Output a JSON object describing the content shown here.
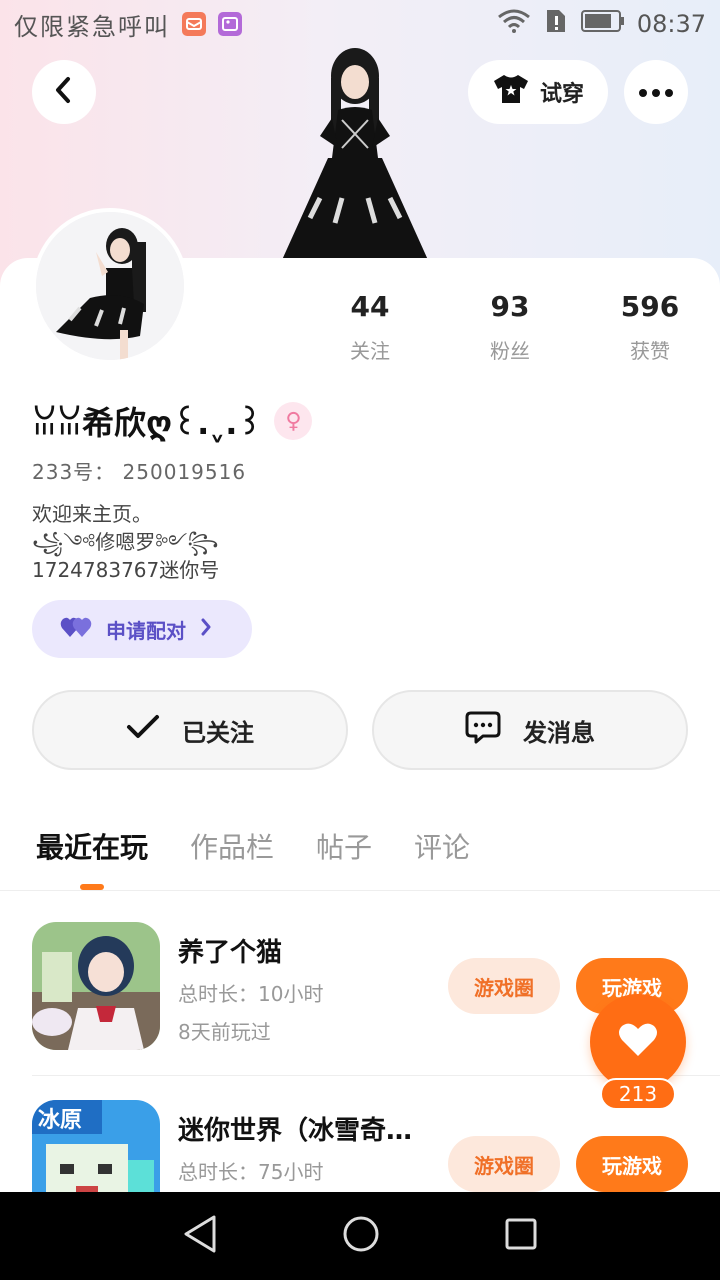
{
  "status_bar": {
    "carrier": "仅限紧急呼叫",
    "time": "08:37"
  },
  "header": {
    "try_on_label": "试穿"
  },
  "profile": {
    "username": "ꈍꈍ希欣ღ꒰.ˬ.꒱",
    "uid_label": "233号：",
    "uid_value": "250019516",
    "bio_line1": "欢迎来主页。",
    "bio_line2": "꧁༺修嗯罗༻꧂",
    "bio_line3": "1724783767迷你号",
    "pair_label": "申请配对"
  },
  "stats": [
    {
      "value": "44",
      "label": "关注"
    },
    {
      "value": "93",
      "label": "粉丝"
    },
    {
      "value": "596",
      "label": "获赞"
    }
  ],
  "actions": {
    "followed_label": "已关注",
    "message_label": "发消息"
  },
  "tabs": [
    "最近在玩",
    "作品栏",
    "帖子",
    "评论"
  ],
  "games": [
    {
      "name": "养了个猫",
      "duration": "总时长：10小时",
      "last_played": "8天前玩过",
      "circle_label": "游戏圈",
      "play_label": "玩游戏"
    },
    {
      "name": "迷你世界（冰雪奇…",
      "duration": "总时长：75小时",
      "circle_label": "游戏圈",
      "play_label": "玩游戏"
    }
  ],
  "like": {
    "count": "213"
  },
  "colors": {
    "accent": "#ff7a1a",
    "pair": "#5b50c6"
  }
}
